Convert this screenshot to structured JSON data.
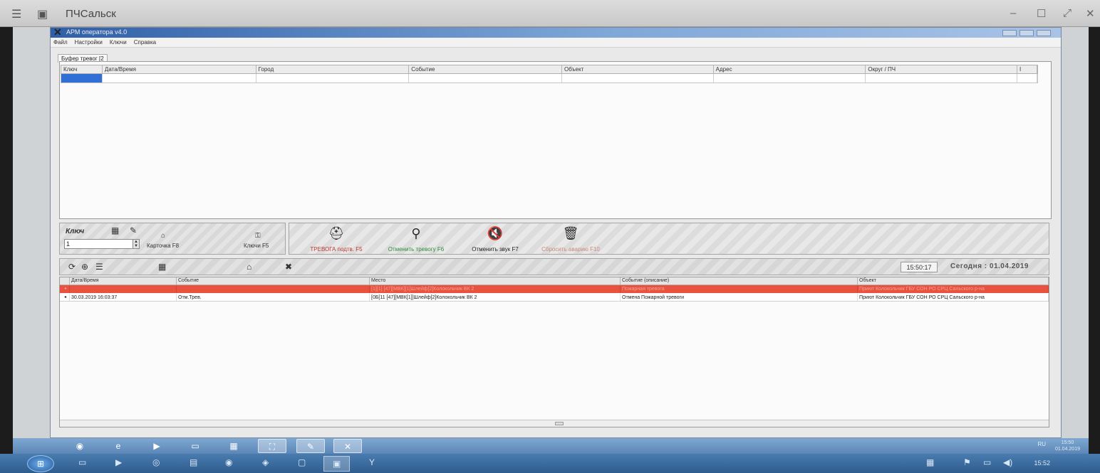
{
  "viewer": {
    "title": "ПЧСальск"
  },
  "app": {
    "title": "АРМ оператора v4.0",
    "menu": [
      "Файл",
      "Настройки",
      "Ключи",
      "Справка"
    ]
  },
  "buffer": {
    "tab_label": "Буфер тревог [2",
    "columns": [
      "Ключ",
      "Дата/Время",
      "Город",
      "Событие",
      "Объект",
      "Адрес",
      "Округ / ПЧ",
      "I"
    ]
  },
  "key_panel": {
    "label": "Ключ",
    "input_value": "1",
    "card_label": "Карточка F8",
    "keys_label": "Ключи F5"
  },
  "actions": [
    {
      "label": "ТРЕВОГА подтв. F5",
      "icon": "alarm-confirm-icon",
      "color": "#c0392b"
    },
    {
      "label": "Отменить тревогу F6",
      "icon": "alarm-cancel-icon",
      "color": "#2e8b3d"
    },
    {
      "label": "Отменить звук F7",
      "icon": "sound-off-icon",
      "color": "#222222"
    },
    {
      "label": "Сбросить аварию F10",
      "icon": "reset-accident-icon",
      "color": "#c98a78"
    }
  ],
  "log": {
    "time": "15:50:17",
    "today": "Сегодня : 01.04.2019",
    "columns": [
      "Дата/Время",
      "Событие",
      "Место",
      "Событие (описание)",
      "Объект"
    ],
    "rows": [
      {
        "type": "alarm",
        "datetime": "",
        "event": "",
        "place": "[1][1] [47][МВК][1]Шлейф[2]Колокольчик ВК 2",
        "description": "Пожарная тревога",
        "object": "Приют Колокольчик ГБУ СОН РО СРЦ Сальского р-на"
      },
      {
        "type": "normal",
        "datetime": "30.03.2019 16:03:37",
        "event": "Отм.Трев.",
        "place": "[0Б[11 [47][МВК[1]]Шлейф[2]Колокольчик ВК 2",
        "description": "Отмена Пожарной тревоги",
        "object": "Приют Колокольчик ГБУ СОН РО СРЦ Сальского р-на"
      }
    ]
  },
  "remote_taskbar": {
    "tray_lang": "RU",
    "clock_time": "15:50",
    "clock_date": "01.04.2019"
  },
  "local_taskbar": {
    "clock_time": "15:52"
  },
  "colors": {
    "alarm_row": "#e8523f",
    "selection": "#2f6fd6",
    "title_gradient_start": "#2f5fa8"
  }
}
